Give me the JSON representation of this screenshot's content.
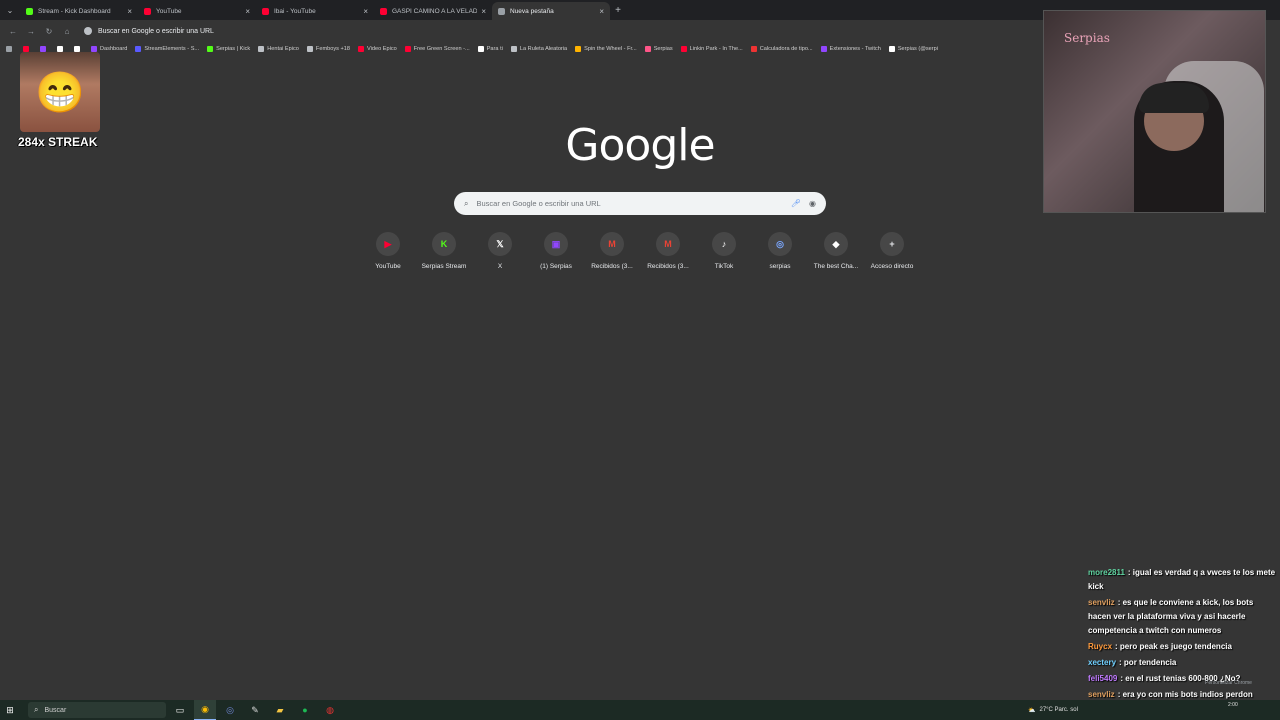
{
  "tabs": [
    {
      "title": "Stream - Kick Dashboard",
      "color": "#53fc18",
      "active": false
    },
    {
      "title": "YouTube",
      "color": "#ff0033",
      "active": false
    },
    {
      "title": "Ibai - YouTube",
      "color": "#ff0033",
      "active": false
    },
    {
      "title": "GASPI CAMINO A LA VELADA",
      "color": "#ff0033",
      "active": false
    },
    {
      "title": "Nueva pestaña",
      "color": "#9aa0a6",
      "active": true
    }
  ],
  "omnibox": {
    "text": "Buscar en Google o escribir una URL"
  },
  "bookmarks": [
    {
      "label": "",
      "color": "#ff0033"
    },
    {
      "label": "",
      "color": "#9146ff"
    },
    {
      "label": "",
      "color": "#ffffff"
    },
    {
      "label": "",
      "color": "#ffffff"
    },
    {
      "label": "Dashboard",
      "color": "#9146ff"
    },
    {
      "label": "StreamElements - S...",
      "color": "#5a5aff"
    },
    {
      "label": "Serpias | Kick",
      "color": "#53fc18"
    },
    {
      "label": "Hentai Epico",
      "color": "#bdc1c6"
    },
    {
      "label": "Femboys +18",
      "color": "#bdc1c6"
    },
    {
      "label": "Video Epico",
      "color": "#ff0033"
    },
    {
      "label": "Free Green Screen -...",
      "color": "#ff0033"
    },
    {
      "label": "Para ti",
      "color": "#ffffff"
    },
    {
      "label": "La Ruleta Aleatoria",
      "color": "#bdc1c6"
    },
    {
      "label": "Spin the Wheel - Fr...",
      "color": "#ffb300"
    },
    {
      "label": "Serpias",
      "color": "#ff5588"
    },
    {
      "label": "Linkin Park - In The...",
      "color": "#ff0033"
    },
    {
      "label": "Calculadora de tipo...",
      "color": "#e33"
    },
    {
      "label": "Extensiones - Twitch",
      "color": "#9146ff"
    },
    {
      "label": "Serpias (@serpi",
      "color": "#ffffff"
    }
  ],
  "google": {
    "logo": "Google",
    "search_placeholder": "Buscar en Google o escribir una URL"
  },
  "shortcuts": [
    {
      "label": "YouTube",
      "glyph": "▶",
      "color": "#ff0033"
    },
    {
      "label": "Serpias Stream",
      "glyph": "K",
      "color": "#53fc18"
    },
    {
      "label": "X",
      "glyph": "𝕏",
      "color": "#ffffff"
    },
    {
      "label": "(1) Serpias",
      "glyph": "▣",
      "color": "#9146ff"
    },
    {
      "label": "Recibidos (3...",
      "glyph": "M",
      "color": "#ea4335"
    },
    {
      "label": "Recibidos (3...",
      "glyph": "M",
      "color": "#ea4335"
    },
    {
      "label": "TikTok",
      "glyph": "♪",
      "color": "#ffffff"
    },
    {
      "label": "serpias",
      "glyph": "◎",
      "color": "#7aa7ff"
    },
    {
      "label": "The best Cha...",
      "glyph": "◆",
      "color": "#ffffff"
    },
    {
      "label": "Acceso directo",
      "glyph": "+",
      "color": "#e8eaed"
    }
  ],
  "overlay": {
    "streak": "284x STREAK"
  },
  "webcam": {
    "label": "Serpias"
  },
  "chat": [
    {
      "user": "more2811",
      "user_color": "#5fd3a0",
      "text": ": igual es verdad q a vwces te los mete kick"
    },
    {
      "user": "senvliz",
      "user_color": "#e0a060",
      "text": ": es que le conviene a kick, los bots hacen ver la plataforma viva y asi hacerle competencia a twitch con numeros"
    },
    {
      "user": "Ruycx",
      "user_color": "#ff9a3c",
      "text": ": pero peak es juego tendencia"
    },
    {
      "user": "xectery",
      "user_color": "#6fd0ff",
      "text": ": por tendencia"
    },
    {
      "user": "feli5409",
      "user_color": "#c07aff",
      "text": ": en el rust tenias 600-800 ¿No?"
    },
    {
      "user": "senvliz",
      "user_color": "#e0a060",
      "text": ": era yo con mis bots indios perdon"
    }
  ],
  "chat_tip": "Personalizar Chrome",
  "taskbar": {
    "search_placeholder": "Buscar",
    "weather": "27°C  Parc. sol",
    "clock": "2:00"
  }
}
